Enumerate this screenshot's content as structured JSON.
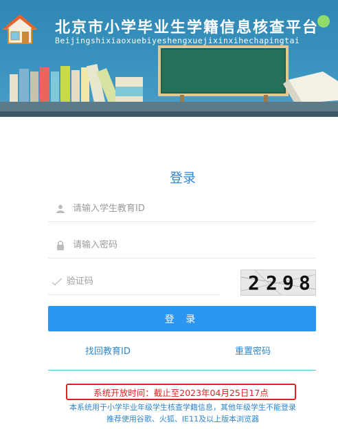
{
  "header": {
    "title_cn": "北京市小学毕业生学籍信息核查平台",
    "title_en": "Beijingshixiaoxuebiyeshengxuejixinxihechapingtai"
  },
  "login": {
    "title": "登录",
    "student_id_placeholder": "请输入学生教育ID",
    "password_placeholder": "请输入密码",
    "captcha_placeholder": "验证码",
    "captcha_text": [
      "2",
      "2",
      "9",
      "8"
    ],
    "submit_label": "登 录"
  },
  "links": {
    "recover_id": "找回教育ID",
    "reset_password": "重置密码"
  },
  "notice": {
    "open_time": "系统开放时间：截止至2023年04月25日17点",
    "info_line1": "本系统用于小学毕业年级学生核查学籍信息，其他年级学生不能登录",
    "info_line2": "推荐使用谷歌、火狐、IE11及以上版本浏览器"
  },
  "colors": {
    "banner": "#3a93bf",
    "accent": "#2b95f2",
    "notice_red": "#e02020"
  },
  "icons": {
    "home": "home-icon",
    "user": "user-icon",
    "lock": "lock-icon",
    "check": "check-icon"
  }
}
